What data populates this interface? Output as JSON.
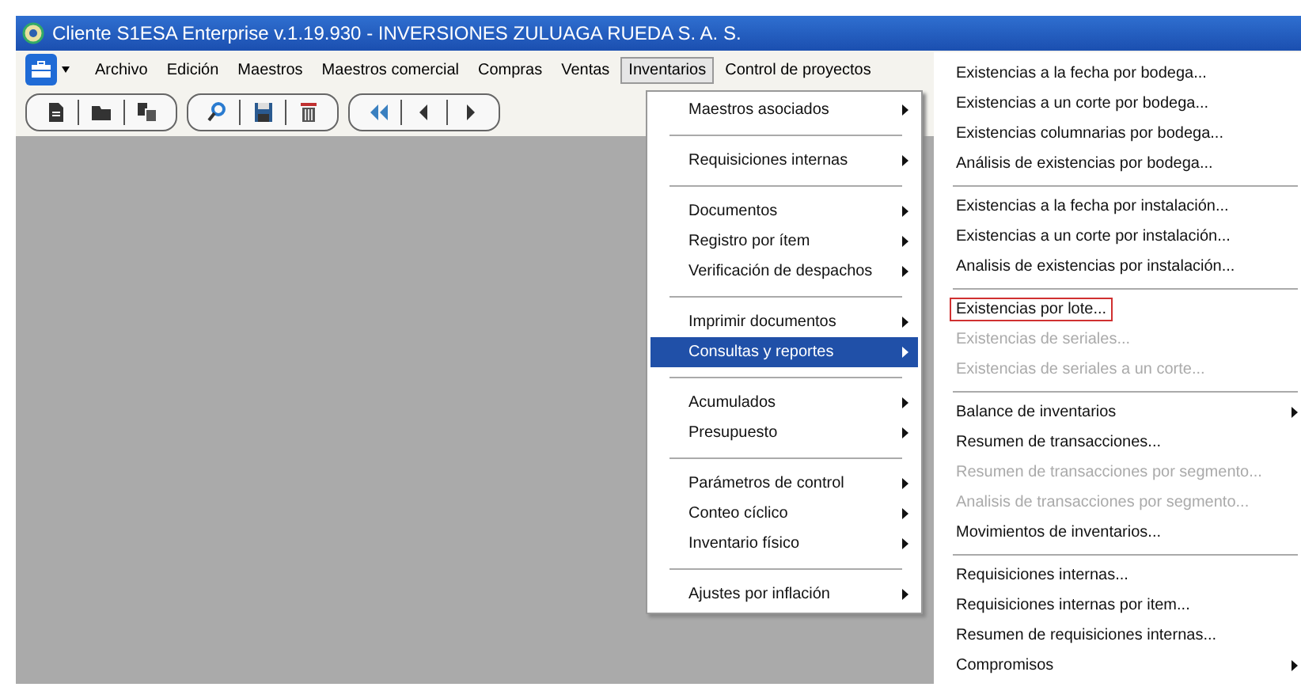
{
  "window": {
    "title": "Cliente S1ESA Enterprise v.1.19.930 - INVERSIONES ZULUAGA RUEDA S. A. S."
  },
  "menubar": [
    {
      "label": "Archivo",
      "selected": false
    },
    {
      "label": "Edición",
      "selected": false
    },
    {
      "label": "Maestros",
      "selected": false
    },
    {
      "label": "Maestros comercial",
      "selected": false
    },
    {
      "label": "Compras",
      "selected": false
    },
    {
      "label": "Ventas",
      "selected": false
    },
    {
      "label": "Inventarios",
      "selected": true
    },
    {
      "label": "Control de proyectos",
      "selected": false
    }
  ],
  "menu": [
    [
      {
        "label": "Maestros asociados",
        "submenu": true,
        "selected": false
      }
    ],
    [
      {
        "label": "Requisiciones internas",
        "submenu": true,
        "selected": false
      }
    ],
    [
      {
        "label": "Documentos",
        "submenu": true,
        "selected": false
      },
      {
        "label": "Registro por ítem",
        "submenu": true,
        "selected": false
      },
      {
        "label": "Verificación de despachos",
        "submenu": true,
        "selected": false
      }
    ],
    [
      {
        "label": "Imprimir documentos",
        "submenu": true,
        "selected": false
      },
      {
        "label": "Consultas y reportes",
        "submenu": true,
        "selected": true
      }
    ],
    [
      {
        "label": "Acumulados",
        "submenu": true,
        "selected": false
      },
      {
        "label": "Presupuesto",
        "submenu": true,
        "selected": false
      }
    ],
    [
      {
        "label": "Parámetros de control",
        "submenu": true,
        "selected": false
      },
      {
        "label": "Conteo cíclico",
        "submenu": true,
        "selected": false
      },
      {
        "label": "Inventario físico",
        "submenu": true,
        "selected": false
      }
    ],
    [
      {
        "label": "Ajustes por inflación",
        "submenu": true,
        "selected": false
      }
    ]
  ],
  "submenu": [
    [
      {
        "label": "Existencias a la fecha por bodega...",
        "disabled": false,
        "submenu": false,
        "highlighted": false
      },
      {
        "label": "Existencias a un corte por bodega...",
        "disabled": false,
        "submenu": false,
        "highlighted": false
      },
      {
        "label": "Existencias columnarias por bodega...",
        "disabled": false,
        "submenu": false,
        "highlighted": false
      },
      {
        "label": "Análisis de existencias por bodega...",
        "disabled": false,
        "submenu": false,
        "highlighted": false
      }
    ],
    [
      {
        "label": "Existencias a la fecha por instalación...",
        "disabled": false,
        "submenu": false,
        "highlighted": false
      },
      {
        "label": "Existencias a un corte por instalación...",
        "disabled": false,
        "submenu": false,
        "highlighted": false
      },
      {
        "label": "Analisis de existencias por instalación...",
        "disabled": false,
        "submenu": false,
        "highlighted": false
      }
    ],
    [
      {
        "label": "Existencias por lote...",
        "disabled": false,
        "submenu": false,
        "highlighted": true
      },
      {
        "label": "Existencias de seriales...",
        "disabled": true,
        "submenu": false,
        "highlighted": false
      },
      {
        "label": "Existencias de seriales a un corte...",
        "disabled": true,
        "submenu": false,
        "highlighted": false
      }
    ],
    [
      {
        "label": "Balance de inventarios",
        "disabled": false,
        "submenu": true,
        "highlighted": false
      },
      {
        "label": "Resumen de transacciones...",
        "disabled": false,
        "submenu": false,
        "highlighted": false
      },
      {
        "label": "Resumen de transacciones por segmento...",
        "disabled": true,
        "submenu": false,
        "highlighted": false
      },
      {
        "label": "Analisis de transacciones por segmento...",
        "disabled": true,
        "submenu": false,
        "highlighted": false
      },
      {
        "label": "Movimientos de inventarios...",
        "disabled": false,
        "submenu": false,
        "highlighted": false
      }
    ],
    [
      {
        "label": "Requisiciones internas...",
        "disabled": false,
        "submenu": false,
        "highlighted": false
      },
      {
        "label": "Requisiciones internas por item...",
        "disabled": false,
        "submenu": false,
        "highlighted": false
      },
      {
        "label": "Resumen de requisiciones internas...",
        "disabled": false,
        "submenu": false,
        "highlighted": false
      },
      {
        "label": "Compromisos",
        "disabled": false,
        "submenu": true,
        "highlighted": false
      }
    ]
  ]
}
